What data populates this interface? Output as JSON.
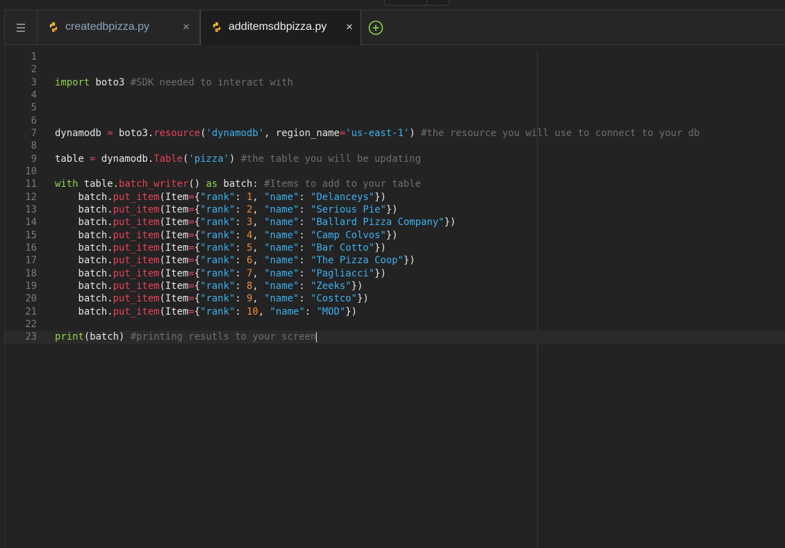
{
  "tabs": [
    {
      "label": "createdbpizza.py",
      "close": "×",
      "icon": "python-icon",
      "active": false
    },
    {
      "label": "additemsdbpizza.py",
      "close": "×",
      "icon": "python-icon",
      "active": true
    }
  ],
  "menu_icon": "hamburger-menu-icon",
  "add_tab_icon": "plus-circle-icon",
  "colors": {
    "keyword": "#8fd64a",
    "comment": "#6f6f6f",
    "string": "#3eb0ef",
    "function": "#e8425a",
    "number": "#f08d3a",
    "background": "#232323"
  },
  "editor": {
    "active_line": 23,
    "lines": [
      {
        "n": "1",
        "tokens": []
      },
      {
        "n": "2",
        "tokens": []
      },
      {
        "n": "3",
        "tokens": [
          {
            "t": "import",
            "k": "k"
          },
          {
            "t": " boto3 "
          },
          {
            "t": "#SDK needed to interact with",
            "k": "c"
          }
        ]
      },
      {
        "n": "4",
        "tokens": []
      },
      {
        "n": "5",
        "tokens": []
      },
      {
        "n": "6",
        "tokens": []
      },
      {
        "n": "7",
        "tokens": [
          {
            "t": "dynamodb "
          },
          {
            "t": "=",
            "k": "o"
          },
          {
            "t": " boto3."
          },
          {
            "t": "resource",
            "k": "f"
          },
          {
            "t": "("
          },
          {
            "t": "'dynamodb'",
            "k": "s"
          },
          {
            "t": ", region_name"
          },
          {
            "t": "=",
            "k": "o"
          },
          {
            "t": "'us-east-1'",
            "k": "s"
          },
          {
            "t": ") "
          },
          {
            "t": "#the resource you will use to connect to your db",
            "k": "c"
          }
        ]
      },
      {
        "n": "8",
        "tokens": []
      },
      {
        "n": "9",
        "tokens": [
          {
            "t": "table "
          },
          {
            "t": "=",
            "k": "o"
          },
          {
            "t": " dynamodb."
          },
          {
            "t": "Table",
            "k": "f"
          },
          {
            "t": "("
          },
          {
            "t": "'pizza'",
            "k": "s"
          },
          {
            "t": ") "
          },
          {
            "t": "#the table you will be updating",
            "k": "c"
          }
        ]
      },
      {
        "n": "10",
        "tokens": []
      },
      {
        "n": "11",
        "tokens": [
          {
            "t": "with",
            "k": "k"
          },
          {
            "t": " table."
          },
          {
            "t": "batch_writer",
            "k": "f"
          },
          {
            "t": "() "
          },
          {
            "t": "as",
            "k": "k"
          },
          {
            "t": " batch: "
          },
          {
            "t": "#Items to add to your table",
            "k": "c"
          }
        ]
      },
      {
        "n": "12",
        "tokens": [
          {
            "t": "    batch."
          },
          {
            "t": "put_item",
            "k": "f"
          },
          {
            "t": "(Item"
          },
          {
            "t": "=",
            "k": "o"
          },
          {
            "t": "{"
          },
          {
            "t": "\"rank\"",
            "k": "s"
          },
          {
            "t": ": "
          },
          {
            "t": "1",
            "k": "n"
          },
          {
            "t": ", "
          },
          {
            "t": "\"name\"",
            "k": "s"
          },
          {
            "t": ": "
          },
          {
            "t": "\"Delanceys\"",
            "k": "s"
          },
          {
            "t": "})"
          }
        ]
      },
      {
        "n": "13",
        "tokens": [
          {
            "t": "    batch."
          },
          {
            "t": "put_item",
            "k": "f"
          },
          {
            "t": "(Item"
          },
          {
            "t": "=",
            "k": "o"
          },
          {
            "t": "{"
          },
          {
            "t": "\"rank\"",
            "k": "s"
          },
          {
            "t": ": "
          },
          {
            "t": "2",
            "k": "n"
          },
          {
            "t": ", "
          },
          {
            "t": "\"name\"",
            "k": "s"
          },
          {
            "t": ": "
          },
          {
            "t": "\"Serious Pie\"",
            "k": "s"
          },
          {
            "t": "})"
          }
        ]
      },
      {
        "n": "14",
        "tokens": [
          {
            "t": "    batch."
          },
          {
            "t": "put_item",
            "k": "f"
          },
          {
            "t": "(Item"
          },
          {
            "t": "=",
            "k": "o"
          },
          {
            "t": "{"
          },
          {
            "t": "\"rank\"",
            "k": "s"
          },
          {
            "t": ": "
          },
          {
            "t": "3",
            "k": "n"
          },
          {
            "t": ", "
          },
          {
            "t": "\"name\"",
            "k": "s"
          },
          {
            "t": ": "
          },
          {
            "t": "\"Ballard Pizza Company\"",
            "k": "s"
          },
          {
            "t": "})"
          }
        ]
      },
      {
        "n": "15",
        "tokens": [
          {
            "t": "    batch."
          },
          {
            "t": "put_item",
            "k": "f"
          },
          {
            "t": "(Item"
          },
          {
            "t": "=",
            "k": "o"
          },
          {
            "t": "{"
          },
          {
            "t": "\"rank\"",
            "k": "s"
          },
          {
            "t": ": "
          },
          {
            "t": "4",
            "k": "n"
          },
          {
            "t": ", "
          },
          {
            "t": "\"name\"",
            "k": "s"
          },
          {
            "t": ": "
          },
          {
            "t": "\"Camp Colvos\"",
            "k": "s"
          },
          {
            "t": "})"
          }
        ]
      },
      {
        "n": "16",
        "tokens": [
          {
            "t": "    batch."
          },
          {
            "t": "put_item",
            "k": "f"
          },
          {
            "t": "(Item"
          },
          {
            "t": "=",
            "k": "o"
          },
          {
            "t": "{"
          },
          {
            "t": "\"rank\"",
            "k": "s"
          },
          {
            "t": ": "
          },
          {
            "t": "5",
            "k": "n"
          },
          {
            "t": ", "
          },
          {
            "t": "\"name\"",
            "k": "s"
          },
          {
            "t": ": "
          },
          {
            "t": "\"Bar Cotto\"",
            "k": "s"
          },
          {
            "t": "})"
          }
        ]
      },
      {
        "n": "17",
        "tokens": [
          {
            "t": "    batch."
          },
          {
            "t": "put_item",
            "k": "f"
          },
          {
            "t": "(Item"
          },
          {
            "t": "=",
            "k": "o"
          },
          {
            "t": "{"
          },
          {
            "t": "\"rank\"",
            "k": "s"
          },
          {
            "t": ": "
          },
          {
            "t": "6",
            "k": "n"
          },
          {
            "t": ", "
          },
          {
            "t": "\"name\"",
            "k": "s"
          },
          {
            "t": ": "
          },
          {
            "t": "\"The Pizza Coop\"",
            "k": "s"
          },
          {
            "t": "})"
          }
        ]
      },
      {
        "n": "18",
        "tokens": [
          {
            "t": "    batch."
          },
          {
            "t": "put_item",
            "k": "f"
          },
          {
            "t": "(Item"
          },
          {
            "t": "=",
            "k": "o"
          },
          {
            "t": "{"
          },
          {
            "t": "\"rank\"",
            "k": "s"
          },
          {
            "t": ": "
          },
          {
            "t": "7",
            "k": "n"
          },
          {
            "t": ", "
          },
          {
            "t": "\"name\"",
            "k": "s"
          },
          {
            "t": ": "
          },
          {
            "t": "\"Pagliacci\"",
            "k": "s"
          },
          {
            "t": "})"
          }
        ]
      },
      {
        "n": "19",
        "tokens": [
          {
            "t": "    batch."
          },
          {
            "t": "put_item",
            "k": "f"
          },
          {
            "t": "(Item"
          },
          {
            "t": "=",
            "k": "o"
          },
          {
            "t": "{"
          },
          {
            "t": "\"rank\"",
            "k": "s"
          },
          {
            "t": ": "
          },
          {
            "t": "8",
            "k": "n"
          },
          {
            "t": ", "
          },
          {
            "t": "\"name\"",
            "k": "s"
          },
          {
            "t": ": "
          },
          {
            "t": "\"Zeeks\"",
            "k": "s"
          },
          {
            "t": "})"
          }
        ]
      },
      {
        "n": "20",
        "tokens": [
          {
            "t": "    batch."
          },
          {
            "t": "put_item",
            "k": "f"
          },
          {
            "t": "(Item"
          },
          {
            "t": "=",
            "k": "o"
          },
          {
            "t": "{"
          },
          {
            "t": "\"rank\"",
            "k": "s"
          },
          {
            "t": ": "
          },
          {
            "t": "9",
            "k": "n"
          },
          {
            "t": ", "
          },
          {
            "t": "\"name\"",
            "k": "s"
          },
          {
            "t": ": "
          },
          {
            "t": "\"Costco\"",
            "k": "s"
          },
          {
            "t": "})"
          }
        ]
      },
      {
        "n": "21",
        "tokens": [
          {
            "t": "    batch."
          },
          {
            "t": "put_item",
            "k": "f"
          },
          {
            "t": "(Item"
          },
          {
            "t": "=",
            "k": "o"
          },
          {
            "t": "{"
          },
          {
            "t": "\"rank\"",
            "k": "s"
          },
          {
            "t": ": "
          },
          {
            "t": "10",
            "k": "n"
          },
          {
            "t": ", "
          },
          {
            "t": "\"name\"",
            "k": "s"
          },
          {
            "t": ": "
          },
          {
            "t": "\"MOD\"",
            "k": "s"
          },
          {
            "t": "})"
          }
        ]
      },
      {
        "n": "22",
        "tokens": []
      },
      {
        "n": "23",
        "tokens": [
          {
            "t": "print",
            "k": "k"
          },
          {
            "t": "(batch) "
          },
          {
            "t": "#printing resutls to your screen",
            "k": "c"
          }
        ]
      }
    ]
  }
}
